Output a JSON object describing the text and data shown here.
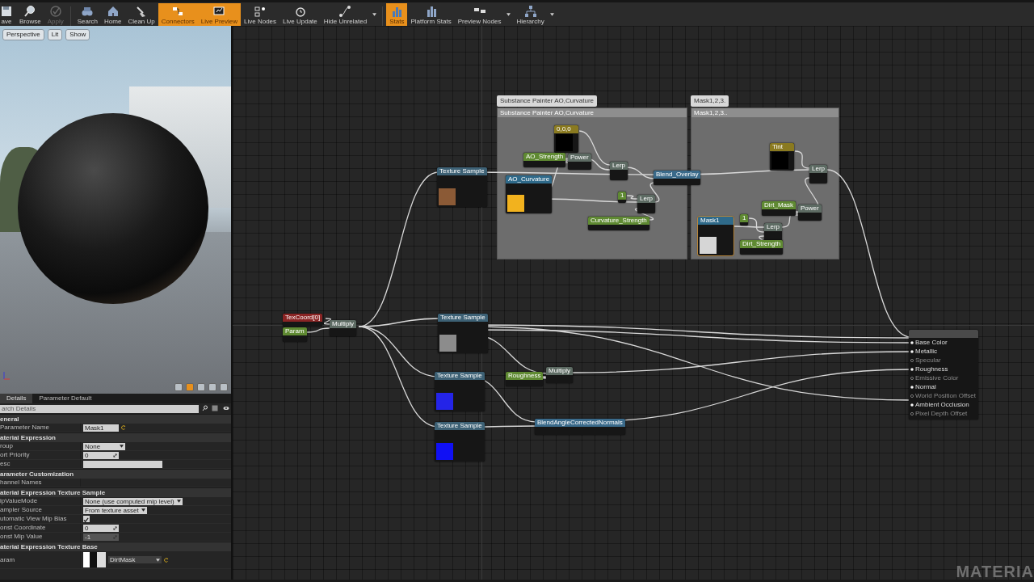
{
  "toolbar": {
    "buttons": [
      {
        "label": "ave",
        "active": false,
        "disabled": false,
        "has_menu": false
      },
      {
        "label": "Browse",
        "active": false,
        "disabled": false,
        "has_menu": false
      },
      {
        "label": "Apply",
        "active": false,
        "disabled": true,
        "has_menu": false
      },
      {
        "label": "Search",
        "active": false,
        "disabled": false,
        "has_menu": false
      },
      {
        "label": "Home",
        "active": false,
        "disabled": false,
        "has_menu": false
      },
      {
        "label": "Clean Up",
        "active": false,
        "disabled": false,
        "has_menu": false
      },
      {
        "label": "Connectors",
        "active": true,
        "disabled": false,
        "has_menu": false
      },
      {
        "label": "Live Preview",
        "active": true,
        "disabled": false,
        "has_menu": false
      },
      {
        "label": "Live Nodes",
        "active": false,
        "disabled": false,
        "has_menu": false
      },
      {
        "label": "Live Update",
        "active": false,
        "disabled": false,
        "has_menu": false
      },
      {
        "label": "Hide Unrelated",
        "active": false,
        "disabled": false,
        "has_menu": true
      },
      {
        "label": "Stats",
        "active": true,
        "disabled": false,
        "has_menu": false
      },
      {
        "label": "Platform Stats",
        "active": false,
        "disabled": false,
        "has_menu": false
      },
      {
        "label": "Preview Nodes",
        "active": false,
        "disabled": false,
        "has_menu": true
      },
      {
        "label": "Hierarchy",
        "active": false,
        "disabled": false,
        "has_menu": true
      }
    ]
  },
  "viewport": {
    "buttons": [
      "Perspective",
      "Lit",
      "Show"
    ],
    "options": [
      {
        "active": false
      },
      {
        "active": true
      },
      {
        "active": false
      },
      {
        "active": false
      },
      {
        "active": false
      }
    ]
  },
  "details": {
    "tabs": [
      {
        "label": "Details",
        "selected": true
      },
      {
        "label": "Parameter Default",
        "selected": false
      }
    ],
    "search": {
      "placeholder": "arch Details"
    },
    "sections": [
      {
        "title": "eneral",
        "rows": [
          {
            "label": "Parameter Name",
            "kind": "text",
            "value": "Mask1",
            "resettable": true
          }
        ]
      },
      {
        "title": "aterial Expression",
        "rows": [
          {
            "label": "roup",
            "kind": "dropdown",
            "value": "None"
          },
          {
            "label": "ort Priority",
            "kind": "number",
            "value": "0",
            "disabled": false
          },
          {
            "label": "esc",
            "kind": "text"
          }
        ]
      },
      {
        "title": "arameter Customization",
        "rows": [
          {
            "label": "hannel Names",
            "kind": "label"
          }
        ]
      },
      {
        "title": "aterial Expression Texture Sample",
        "rows": [
          {
            "label": "ipValueMode",
            "kind": "dropdown",
            "value": "None (use computed mip level)"
          },
          {
            "label": "ampler Source",
            "kind": "dropdown",
            "value": "From texture asset"
          },
          {
            "label": "utomatic View Mip Bias",
            "kind": "checkbox",
            "checked": true
          },
          {
            "label": "onst Coordinate",
            "kind": "number",
            "value": "0",
            "disabled": false
          },
          {
            "label": "onst Mip Value",
            "kind": "number",
            "value": "-1",
            "disabled": true
          }
        ]
      },
      {
        "title": "aterial Expression Texture Base",
        "rows": [
          {
            "label": "aram",
            "kind": "texture",
            "value": "DirtMask",
            "resettable": true
          }
        ]
      }
    ]
  },
  "graph": {
    "comments": [
      {
        "bubble": "Substance Painter AO,Curvature",
        "header": "Substance Painter AO,Curvature"
      },
      {
        "bubble": "Mask1,2,3.",
        "header": "Mask1,2,3.."
      }
    ],
    "nodes": [
      {
        "kind": "coord",
        "title": "TexCoord[0]"
      },
      {
        "kind": "scalar",
        "title": "Param"
      },
      {
        "kind": "math",
        "title": "Multiply"
      },
      {
        "kind": "texture",
        "title": "Texture Sample",
        "color": "#8b5a36"
      },
      {
        "kind": "texture",
        "title": "Texture Sample",
        "color": "#8c8c8c"
      },
      {
        "kind": "texture",
        "title": "Texture Sample",
        "color": "#2424e8"
      },
      {
        "kind": "texture",
        "title": "Texture Sample",
        "color": "#1010f4"
      },
      {
        "kind": "scalar",
        "title": "Roughness"
      },
      {
        "kind": "math",
        "title": "Multiply"
      },
      {
        "kind": "function",
        "title": "BlendAngleCorrectedNormals"
      },
      {
        "kind": "output",
        "pins": [
          {
            "label": "Base Color",
            "connected": true
          },
          {
            "label": "Metallic",
            "connected": true
          },
          {
            "label": "Specular",
            "connected": false
          },
          {
            "label": "Roughness",
            "connected": true
          },
          {
            "label": "Emissive Color",
            "connected": false
          },
          {
            "label": "Normal",
            "connected": true
          },
          {
            "label": "World Position Offset",
            "connected": false
          },
          {
            "label": "Ambient Occlusion",
            "connected": true
          },
          {
            "label": "Pixel Depth Offset",
            "connected": false
          }
        ]
      },
      {
        "kind": "texture-param",
        "title": "AO_Curvature",
        "color": "#f2b21e"
      },
      {
        "kind": "vector",
        "title": "0,0,0",
        "color": "#000000"
      },
      {
        "kind": "scalar",
        "title": "AO_Strength"
      },
      {
        "kind": "math",
        "title": "Power"
      },
      {
        "kind": "math",
        "title": "Lerp"
      },
      {
        "kind": "scalar",
        "title": "1"
      },
      {
        "kind": "math",
        "title": "Lerp"
      },
      {
        "kind": "scalar",
        "title": "Curvature_Strength"
      },
      {
        "kind": "function",
        "title": "Blend_Overlay"
      },
      {
        "kind": "vector",
        "title": "Tint",
        "color": "#000000"
      },
      {
        "kind": "math",
        "title": "Lerp"
      },
      {
        "kind": "texture-param",
        "title": "Mask1",
        "color": "#d6d6d6"
      },
      {
        "kind": "scalar",
        "title": "1"
      },
      {
        "kind": "scalar",
        "title": "Dirt_Mask"
      },
      {
        "kind": "math",
        "title": "Lerp"
      },
      {
        "kind": "math",
        "title": "Power"
      },
      {
        "kind": "scalar",
        "title": "Dirt_Strength"
      }
    ],
    "corner_label": "MATERIA"
  }
}
